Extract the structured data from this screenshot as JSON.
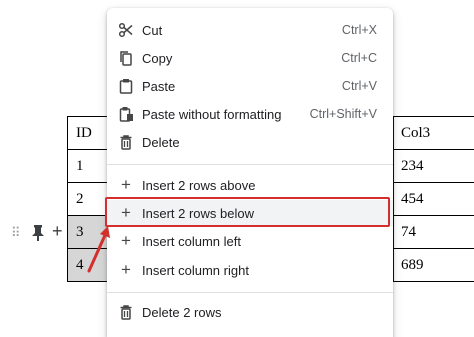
{
  "table": {
    "header_first": "ID",
    "ids": [
      "1",
      "2",
      "3",
      "4"
    ],
    "col3_header": "Col3",
    "col3_values": [
      "234",
      "454",
      "74",
      "689"
    ]
  },
  "menu": {
    "cut": {
      "label": "Cut",
      "shortcut": "Ctrl+X",
      "icon": "scissors-icon"
    },
    "copy": {
      "label": "Copy",
      "shortcut": "Ctrl+C",
      "icon": "copy-icon"
    },
    "paste": {
      "label": "Paste",
      "shortcut": "Ctrl+V",
      "icon": "clipboard-icon"
    },
    "paste_plain": {
      "label": "Paste without formatting",
      "shortcut": "Ctrl+Shift+V",
      "icon": "clipboard-plain-icon"
    },
    "delete": {
      "label": "Delete",
      "icon": "trash-icon"
    },
    "insert_rows_above": {
      "label": "Insert 2 rows above",
      "icon": "plus-icon"
    },
    "insert_rows_below": {
      "label": "Insert 2 rows below",
      "icon": "plus-icon"
    },
    "insert_col_left": {
      "label": "Insert column left",
      "icon": "plus-icon"
    },
    "insert_col_right": {
      "label": "Insert column right",
      "icon": "plus-icon"
    },
    "delete_rows": {
      "label": "Delete 2 rows",
      "icon": "trash-icon"
    }
  },
  "gutter": {
    "add_symbol": "+",
    "handle_symbol": "⠿"
  },
  "colors": {
    "highlight_border": "#d32f2f",
    "selection_fill": "#d6d6d6",
    "arrow": "#d32f2f"
  }
}
